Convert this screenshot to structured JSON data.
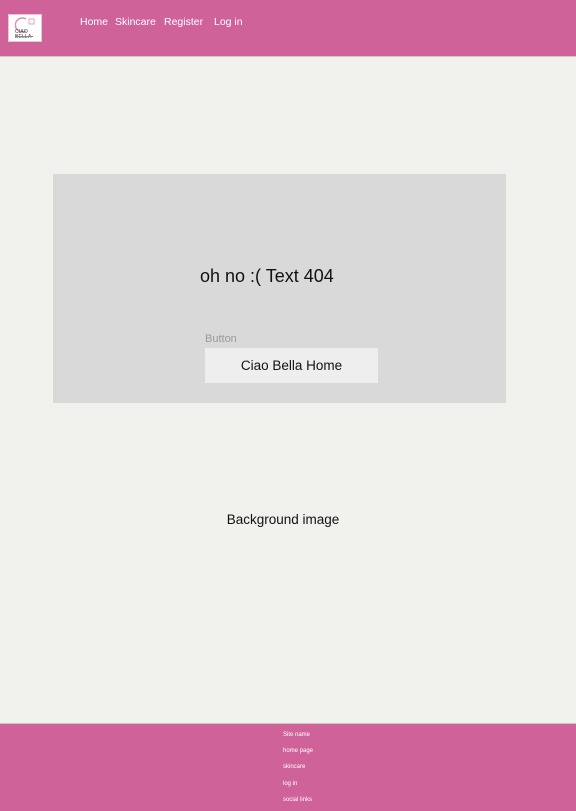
{
  "header": {
    "logo": {
      "wordmark": "CIAO BELLA"
    },
    "nav": {
      "home": "Home",
      "skincare": "Skincare",
      "register": "Register",
      "login": "Log in"
    }
  },
  "main": {
    "error_text": "oh no :( Text 404",
    "button_caption": "Button",
    "home_button_label": "Ciao Bella Home",
    "background_label": "Background image"
  },
  "footer": {
    "site_name": "Site name",
    "home_page": "home page",
    "skincare": "skincare",
    "login": "log in",
    "social_links": "social links"
  },
  "colors": {
    "header_bg": "#D0629A",
    "page_bg": "#F1F2EE",
    "card_bg": "#D9D9D9",
    "button_bg": "#EEEEEE",
    "footer_bg": "#D0629A"
  }
}
